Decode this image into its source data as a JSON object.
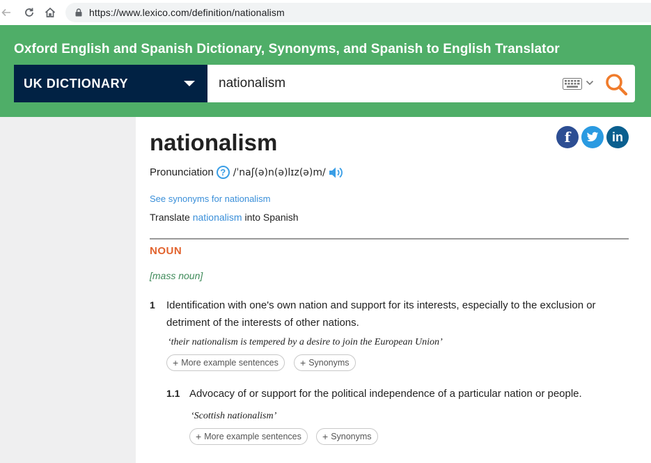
{
  "browser": {
    "url": "https://www.lexico.com/definition/nationalism"
  },
  "header": {
    "title": "Oxford English and Spanish Dictionary, Synonyms, and Spanish to English Translator",
    "dictionary_select": "UK DICTIONARY",
    "search_value": "nationalism"
  },
  "entry": {
    "headword": "nationalism",
    "pronunciation_label": "Pronunciation",
    "help_glyph": "?",
    "ipa": "/ˈnaʃ(ə)n(ə)lɪz(ə)m/",
    "synonyms_link": "See synonyms for nationalism",
    "translate_prefix": "Translate",
    "translate_word": "nationalism",
    "translate_suffix": "into Spanish",
    "pos": "NOUN",
    "grammar": "[mass noun]",
    "senses": [
      {
        "number": "1",
        "definition_line1": "Identification with one's own nation and support for its interests, especially to the exclusion or",
        "definition_line2": "detriment of the interests of other nations.",
        "example": "‘their nationalism is tempered by a desire to join the European Union’",
        "more_examples": "More example sentences",
        "synonyms": "Synonyms"
      },
      {
        "number": "1.1",
        "definition": "Advocacy of or support for the political independence of a particular nation or people.",
        "example": "‘Scottish nationalism’",
        "more_examples": "More example sentences",
        "synonyms": "Synonyms"
      }
    ]
  },
  "social": {
    "facebook": "f",
    "linkedin": "in"
  },
  "colors": {
    "header_green": "#4fae68",
    "dict_navy": "#012244",
    "search_orange": "#f07c2c",
    "pos_orange": "#e2632e",
    "link_blue": "#3a8fd9",
    "grammar_green": "#3f8b5a"
  },
  "icons": [
    "back-arrow-icon",
    "reload-icon",
    "home-icon",
    "lock-icon",
    "keyboard-icon",
    "chevron-down-icon",
    "search-icon",
    "facebook-icon",
    "twitter-icon",
    "linkedin-icon",
    "help-icon",
    "audio-icon",
    "plus-icon"
  ]
}
